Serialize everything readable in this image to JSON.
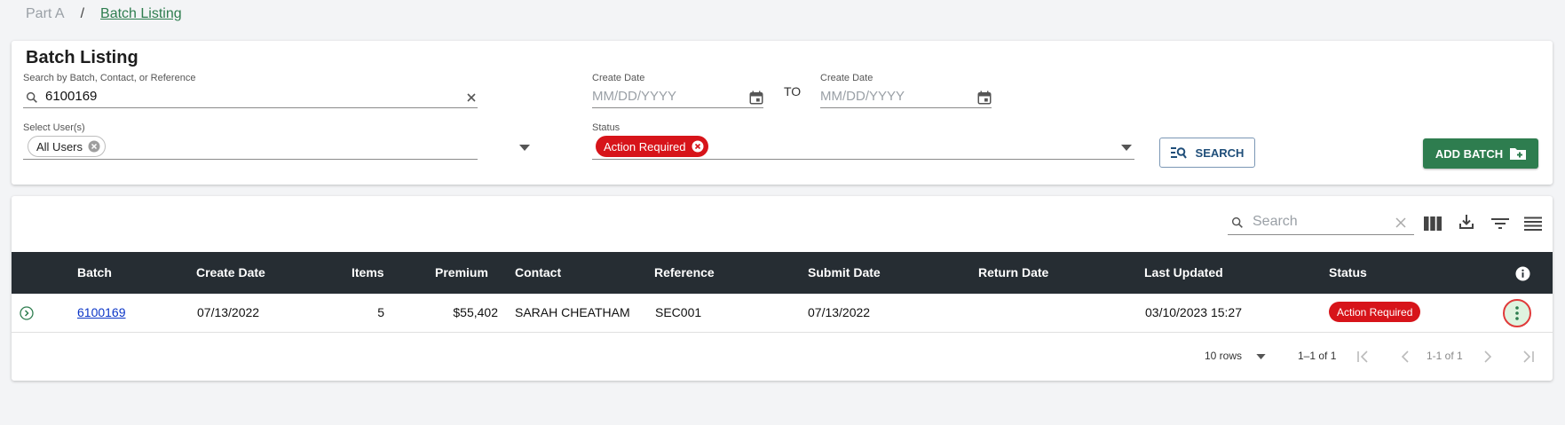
{
  "breadcrumb": {
    "parent": "Part A",
    "separator": "/",
    "current": "Batch Listing"
  },
  "filters": {
    "title": "Batch Listing",
    "search_label": "Search by Batch, Contact, or Reference",
    "search_value": "6100169",
    "create_date_from_label": "Create Date",
    "create_date_from_placeholder": "MM/DD/YYYY",
    "to_label": "TO",
    "create_date_to_label": "Create Date",
    "create_date_to_placeholder": "MM/DD/YYYY",
    "users_label": "Select User(s)",
    "users_chip": "All Users",
    "status_label": "Status",
    "status_chip": "Action Required",
    "search_button": "SEARCH",
    "add_button": "ADD BATCH"
  },
  "table": {
    "search_placeholder": "Search",
    "columns": [
      "Batch",
      "Create Date",
      "Items",
      "Premium",
      "Contact",
      "Reference",
      "Submit Date",
      "Return Date",
      "Last Updated",
      "Status"
    ],
    "rows": [
      {
        "batch": "6100169",
        "create_date": "07/13/2022",
        "items": "5",
        "premium": "$55,402",
        "contact": "SARAH CHEATHAM",
        "reference": "SEC001",
        "submit_date": "07/13/2022",
        "return_date": "",
        "last_updated": "03/10/2023 15:27",
        "status": "Action Required"
      }
    ],
    "footer": {
      "rows_per_page": "10 rows",
      "range": "1–1 of 1",
      "page_info": "1-1 of 1"
    }
  },
  "colors": {
    "accent_green": "#2e7d4f",
    "status_red": "#d7141a",
    "header_dark": "#262d33",
    "link_blue": "#0b35c7"
  }
}
